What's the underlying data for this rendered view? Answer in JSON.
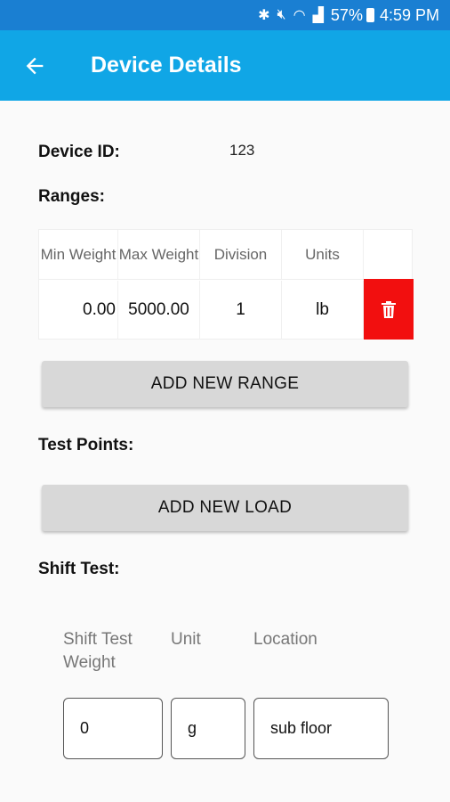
{
  "status_bar": {
    "battery": "57%",
    "time": "4:59 PM"
  },
  "app_bar": {
    "title": "Device Details"
  },
  "device": {
    "id_label": "Device ID:",
    "id_value": "123"
  },
  "ranges": {
    "label": "Ranges:",
    "headers": [
      "Min Weight",
      "Max Weight",
      "Division",
      "Units"
    ],
    "rows": [
      {
        "min": "0.00",
        "max": "5000.00",
        "division": "1",
        "units": "lb"
      }
    ],
    "add_button": "ADD NEW RANGE"
  },
  "test_points": {
    "label": "Test Points:",
    "add_button": "ADD NEW LOAD"
  },
  "shift_test": {
    "label": "Shift Test:",
    "headers": {
      "weight": "Shift Test Weight",
      "unit": "Unit",
      "location": "Location"
    },
    "values": {
      "weight": "0",
      "unit": "g",
      "location": "sub floor"
    }
  },
  "colors": {
    "status_bar": "#1a7fd2",
    "app_bar": "#10a6e6",
    "delete": "#f20f0f",
    "button": "#d8d8d8"
  },
  "icons": [
    "bluetooth-icon",
    "mute-icon",
    "wifi-icon",
    "signal-icon",
    "battery-icon",
    "back-arrow-icon",
    "trash-icon"
  ]
}
